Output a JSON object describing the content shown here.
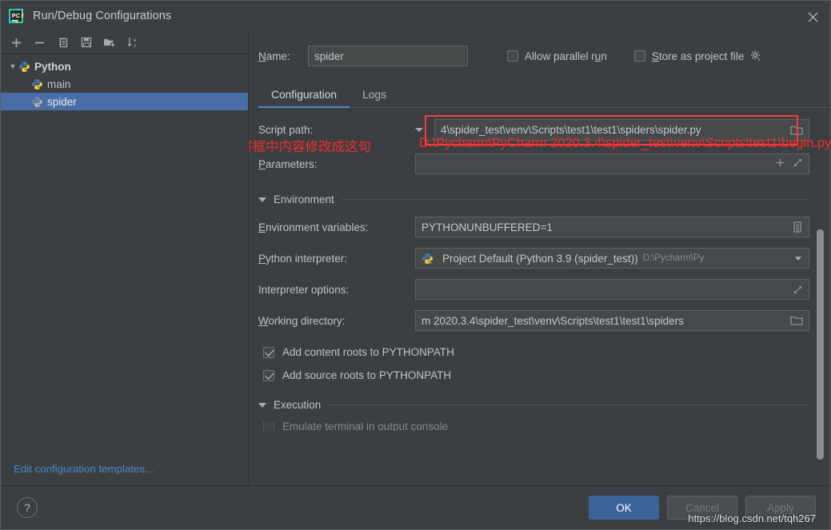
{
  "window": {
    "title": "Run/Debug Configurations",
    "app_icon": "pycharm-logo-icon",
    "close_icon": "close-icon"
  },
  "sidebar": {
    "toolbar": [
      {
        "name": "add-configuration-button",
        "icon": "plus-icon",
        "glyph": "+"
      },
      {
        "name": "remove-configuration-button",
        "icon": "minus-icon",
        "glyph": "−"
      },
      {
        "name": "copy-configuration-button",
        "icon": "copy-icon",
        "glyph": "copy"
      },
      {
        "name": "save-configuration-button",
        "icon": "save-icon",
        "glyph": "save"
      },
      {
        "name": "new-folder-button",
        "icon": "folder-add-icon",
        "glyph": "folder-plus"
      },
      {
        "name": "sort-configurations-button",
        "icon": "sort-alphabetical-icon",
        "glyph": "sort-az"
      }
    ],
    "tree": [
      {
        "label": "Python",
        "type": "group",
        "expanded": true,
        "icon": "python-icon",
        "selected": false
      },
      {
        "label": "main",
        "type": "child",
        "icon": "python-icon",
        "selected": false
      },
      {
        "label": "spider",
        "type": "child",
        "icon": "python-icon",
        "selected": true
      }
    ],
    "edit_templates_link": "Edit configuration templates..."
  },
  "main": {
    "name_label": "Name:",
    "name_value": "spider",
    "name_placeholder": "",
    "allow_parallel_run": {
      "label": "Allow parallel run",
      "checked": false
    },
    "store_as_project_file": {
      "label": "Store as project file",
      "checked": false,
      "gear_icon": "gear-icon"
    },
    "tabs": [
      {
        "label": "Configuration",
        "active": true
      },
      {
        "label": "Logs",
        "active": false
      }
    ],
    "fields": {
      "script_path_label": "Script path:",
      "script_path_value": "4\\spider_test\\venv\\Scripts\\test1\\test1\\spiders\\spider.py",
      "script_path_browse_icon": "folder-browse-icon",
      "parameters_label": "Parameters:",
      "parameters_value": "",
      "parameters_add_icon": "plus-icon",
      "parameters_expand_icon": "expand-icon",
      "environment_section": "Environment",
      "env_vars_label": "Environment variables:",
      "env_vars_value": "PYTHONUNBUFFERED=1",
      "env_vars_browse_icon": "list-edit-icon",
      "python_interpreter_label": "Python interpreter:",
      "python_interpreter_value": "Project Default (Python 3.9 (spider_test))",
      "python_interpreter_hint": "D:\\Pycharm\\Py",
      "python_interpreter_icon": "python-venv-icon",
      "python_interpreter_dropdown_icon": "chevron-down-icon",
      "interpreter_options_label": "Interpreter options:",
      "interpreter_options_value": "",
      "interpreter_options_expand_icon": "expand-icon",
      "working_directory_label": "Working directory:",
      "working_directory_value": "m 2020.3.4\\spider_test\\venv\\Scripts\\test1\\test1\\spiders",
      "working_directory_browse_icon": "folder-browse-icon",
      "add_content_roots": {
        "label": "Add content roots to PYTHONPATH",
        "checked": true
      },
      "add_source_roots": {
        "label": "Add source roots to PYTHONPATH",
        "checked": true
      },
      "execution_section": "Execution",
      "emulate_terminal": {
        "label": "Emulate terminal in output console",
        "checked": false
      }
    }
  },
  "annotations": {
    "chinese_note": "将框中内容修改成这句",
    "red_path": "D:\\Pycharm\\PyCharm 2020.3.4\\spider_test\\venv\\Scripts\\test1\\begin.py",
    "highlight_color": "#f53c3c",
    "note_color": "#f42b2b"
  },
  "footer": {
    "help_label": "?",
    "ok_label": "OK",
    "cancel_label": "Cancel",
    "apply_label": "Apply",
    "ok_color": "#3c6398"
  },
  "watermark": "https://blog.csdn.net/tqh267"
}
